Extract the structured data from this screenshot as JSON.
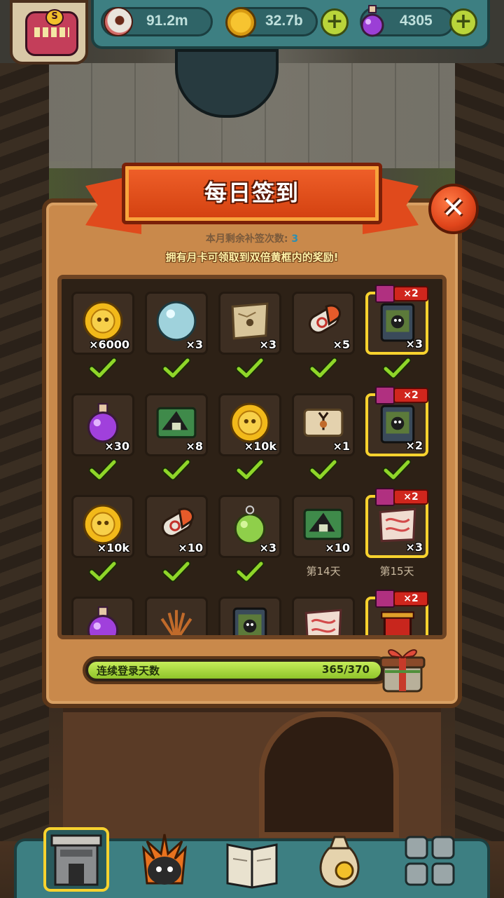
{
  "resources": [
    {
      "name": "eyeball",
      "icon": "eyeball-icon",
      "value": "91.2m",
      "has_plus": false
    },
    {
      "name": "coin",
      "icon": "gold-coin-icon",
      "value": "32.7b",
      "has_plus": true
    },
    {
      "name": "potion",
      "icon": "purple-potion-icon",
      "value": "4305",
      "has_plus": true
    }
  ],
  "avatar": {
    "badge": "S"
  },
  "dialog": {
    "title": "每日签到",
    "remaining_label": "本月剩余补签次数:",
    "remaining_value": "3",
    "notice": "拥有月卡可领取到双倍黄框内的奖励!",
    "double_label": "×2",
    "rows": [
      [
        {
          "item": "gold-coin",
          "qty": "×6000",
          "claimed": true,
          "double": false
        },
        {
          "item": "crystal-orb",
          "qty": "×3",
          "claimed": true,
          "double": false
        },
        {
          "item": "treasure-map",
          "qty": "×3",
          "claimed": true,
          "double": false
        },
        {
          "item": "bone-capsule",
          "qty": "×5",
          "claimed": true,
          "double": false
        },
        {
          "item": "monster-card",
          "qty": "×3",
          "claimed": true,
          "double": true
        }
      ],
      [
        {
          "item": "purple-potion",
          "qty": "×30",
          "claimed": true,
          "double": false
        },
        {
          "item": "blueprint-scroll",
          "qty": "×8",
          "claimed": true,
          "double": false
        },
        {
          "item": "gold-coin",
          "qty": "×10k",
          "claimed": true,
          "double": false
        },
        {
          "item": "deer-ticket",
          "qty": "×1",
          "claimed": true,
          "double": false
        },
        {
          "item": "monster-card",
          "qty": "×2",
          "claimed": true,
          "double": true
        }
      ],
      [
        {
          "item": "gold-coin",
          "qty": "×10k",
          "claimed": true,
          "double": false
        },
        {
          "item": "bone-capsule",
          "qty": "×10",
          "claimed": true,
          "double": false
        },
        {
          "item": "green-potion",
          "qty": "×3",
          "claimed": true,
          "double": false
        },
        {
          "item": "blueprint-scroll",
          "qty": "×10",
          "claimed": false,
          "double": false,
          "day": "第14天"
        },
        {
          "item": "red-scroll",
          "qty": "×3",
          "claimed": false,
          "double": true,
          "day": "第15天"
        }
      ],
      [
        {
          "item": "purple-potion",
          "qty": "",
          "claimed": false,
          "double": false
        },
        {
          "item": "feather-plant",
          "qty": "",
          "claimed": false,
          "double": false
        },
        {
          "item": "monster-card",
          "qty": "",
          "claimed": false,
          "double": false
        },
        {
          "item": "red-scroll",
          "qty": "",
          "claimed": false,
          "double": false
        },
        {
          "item": "red-box",
          "qty": "",
          "claimed": false,
          "double": true
        }
      ]
    ],
    "progress": {
      "label": "连续登录天数",
      "value_text": "365/370",
      "current": 365,
      "total": 370
    }
  },
  "bottom_nav": [
    {
      "name": "building",
      "icon": "building-icon",
      "selected": true
    },
    {
      "name": "monster",
      "icon": "monster-icon",
      "selected": false
    },
    {
      "name": "book",
      "icon": "book-icon",
      "selected": false
    },
    {
      "name": "bag",
      "icon": "money-bag-icon",
      "selected": false
    },
    {
      "name": "menu",
      "icon": "grid-menu-icon",
      "selected": false
    }
  ],
  "colors": {
    "gold_frame": "#f7d22e",
    "check": "#8fd629",
    "banner": "#e04a1c",
    "progress": "#a6d83a"
  }
}
